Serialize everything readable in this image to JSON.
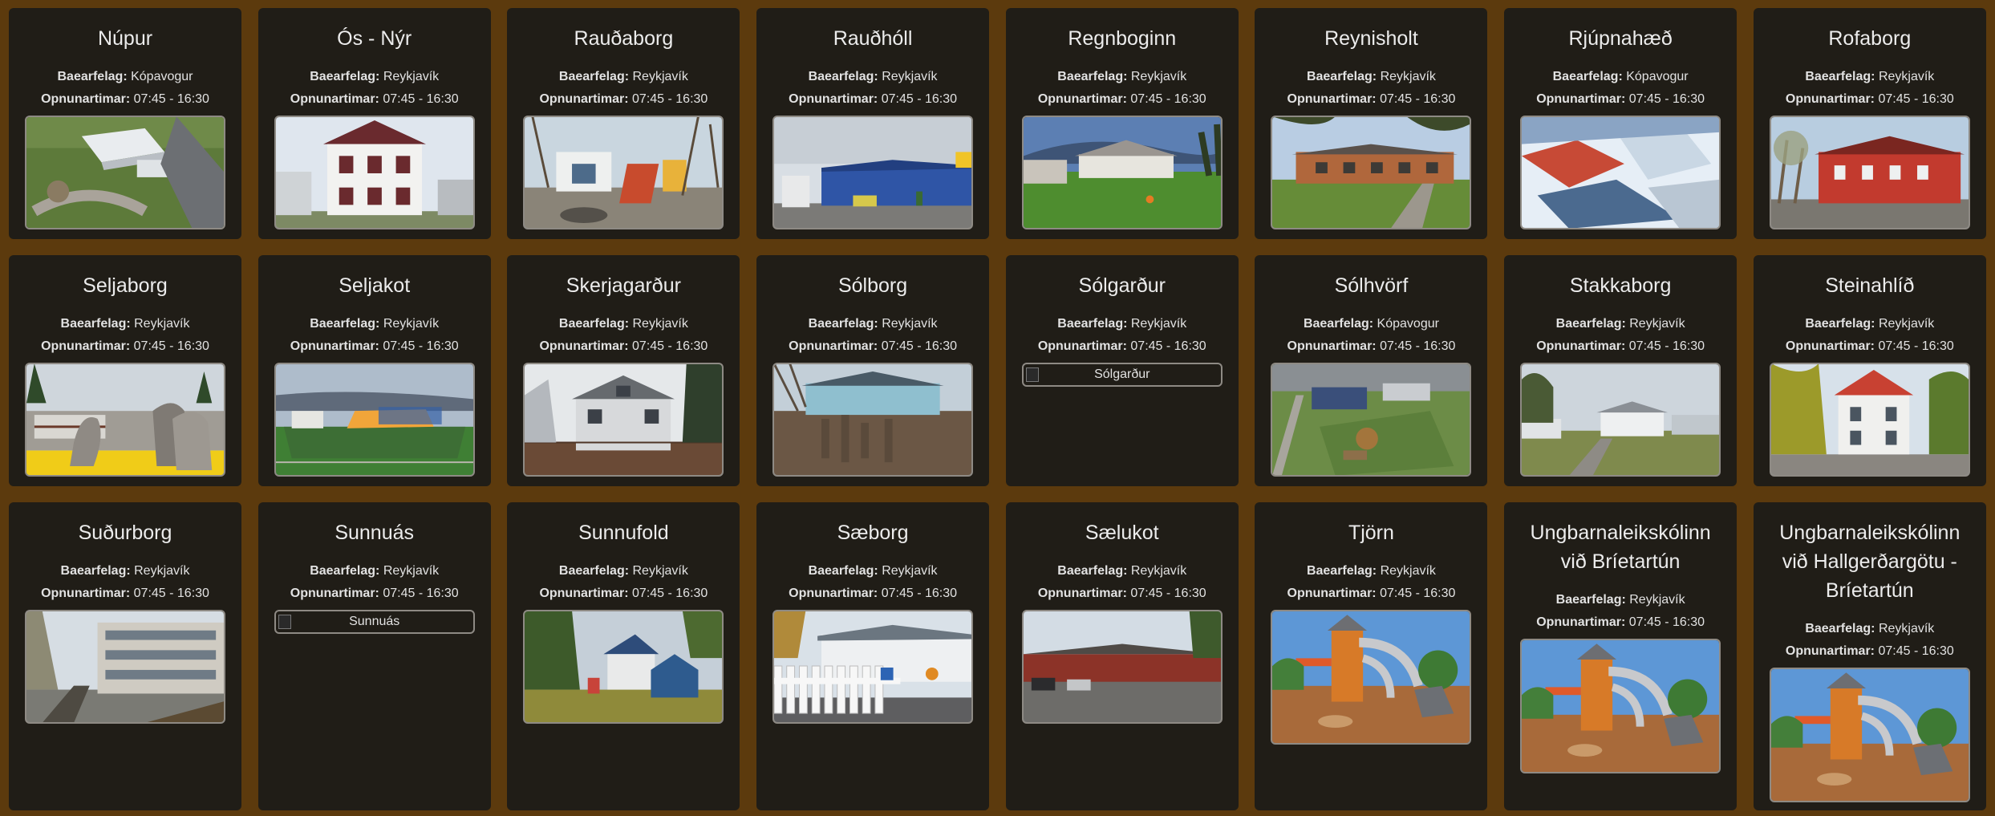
{
  "labels": {
    "municipality": "Baearfelag:",
    "hours": "Opnunartimar:"
  },
  "cards": [
    {
      "name": "Núpur",
      "town": "Kópavogur",
      "hours": "07:45 - 16:30",
      "image": "aerial-campus"
    },
    {
      "name": "Ós - Nýr",
      "town": "Reykjavík",
      "hours": "07:45 - 16:30",
      "image": "white-house"
    },
    {
      "name": "Rauðaborg",
      "town": "Reykjavík",
      "hours": "07:45 - 16:30",
      "image": "playground"
    },
    {
      "name": "Rauðhóll",
      "town": "Reykjavík",
      "hours": "07:45 - 16:30",
      "image": "blue-building"
    },
    {
      "name": "Regnboginn",
      "town": "Reykjavík",
      "hours": "07:45 - 16:30",
      "image": "green-lawn"
    },
    {
      "name": "Reynisholt",
      "town": "Reykjavík",
      "hours": "07:45 - 16:30",
      "image": "brown-building"
    },
    {
      "name": "Rjúpnahæð",
      "town": "Kópavogur",
      "hours": "07:45 - 16:30",
      "image": "snowy-aerial"
    },
    {
      "name": "Rofaborg",
      "town": "Reykjavík",
      "hours": "07:45 - 16:30",
      "image": "red-house"
    },
    {
      "name": "Seljaborg",
      "town": "Reykjavík",
      "hours": "07:45 - 16:30",
      "image": "yellow-ground"
    },
    {
      "name": "Seljakot",
      "town": "Reykjavík",
      "hours": "07:45 - 16:30",
      "image": "green-field"
    },
    {
      "name": "Skerjagarður",
      "town": "Reykjavík",
      "hours": "07:45 - 16:30",
      "image": "grey-house"
    },
    {
      "name": "Sólborg",
      "town": "Reykjavík",
      "hours": "07:45 - 16:30",
      "image": "dirt-yard"
    },
    {
      "name": "Sólgarður",
      "town": "Reykjavík",
      "hours": "07:45 - 16:30",
      "image": "",
      "alt": "Sólgarður"
    },
    {
      "name": "Sólhvörf",
      "town": "Kópavogur",
      "hours": "07:45 - 16:30",
      "image": "aerial-green"
    },
    {
      "name": "Stakkaborg",
      "town": "Reykjavík",
      "hours": "07:45 - 16:30",
      "image": "white-buildings"
    },
    {
      "name": "Steinahlíð",
      "town": "Reykjavík",
      "hours": "07:45 - 16:30",
      "image": "autumn-house"
    },
    {
      "name": "Suðurborg",
      "town": "Reykjavík",
      "hours": "07:45 - 16:30",
      "image": "school-building"
    },
    {
      "name": "Sunnuás",
      "town": "Reykjavík",
      "hours": "07:45 - 16:30",
      "image": "",
      "alt": "Sunnuás"
    },
    {
      "name": "Sunnufold",
      "town": "Reykjavík",
      "hours": "07:45 - 16:30",
      "image": "forest-house"
    },
    {
      "name": "Sæborg",
      "town": "Reykjavík",
      "hours": "07:45 - 16:30",
      "image": "white-fence"
    },
    {
      "name": "Sælukot",
      "town": "Reykjavík",
      "hours": "07:45 - 16:30",
      "image": "red-low-building"
    },
    {
      "name": "Tjörn",
      "town": "Reykjavík",
      "hours": "07:45 - 16:30",
      "image": "play-tower"
    },
    {
      "name": "Ungbarnaleikskólinn við Bríetartún",
      "town": "Reykjavík",
      "hours": "07:45 - 16:30",
      "image": "play-tower"
    },
    {
      "name": "Ungbarnaleikskólinn við Hallgerðargötu - Bríetartún",
      "town": "Reykjavík",
      "hours": "07:45 - 16:30",
      "image": "play-tower"
    }
  ]
}
